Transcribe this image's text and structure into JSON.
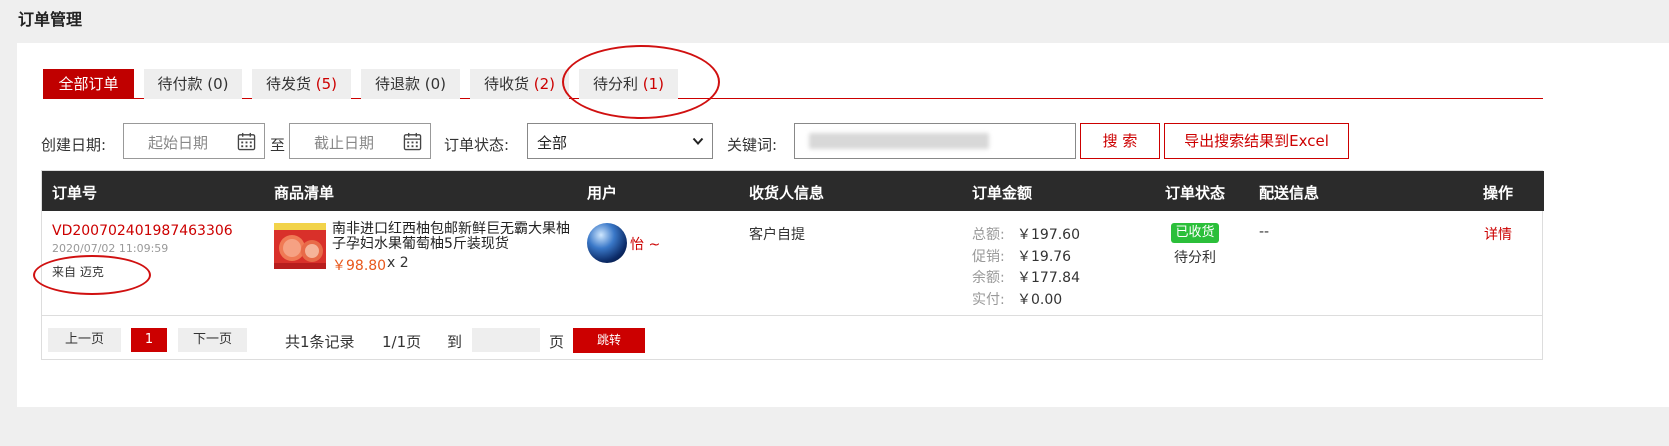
{
  "page": {
    "title": "订单管理"
  },
  "tabs": [
    {
      "label": "全部订单",
      "count": ""
    },
    {
      "label": "待付款",
      "count": "(0)"
    },
    {
      "label": "待发货",
      "count": "(5)"
    },
    {
      "label": "待退款",
      "count": "(0)"
    },
    {
      "label": "待收货",
      "count": "(2)"
    },
    {
      "label": "待分利",
      "count": "(1)"
    }
  ],
  "filters": {
    "date_label": "创建日期:",
    "start_placeholder": "起始日期",
    "to_label": "至",
    "end_placeholder": "截止日期",
    "status_label": "订单状态:",
    "status_value": "全部",
    "keyword_label": "关键词:",
    "search_button": "搜 索",
    "export_button": "导出搜索结果到Excel"
  },
  "table": {
    "headers": [
      "订单号",
      "商品清单",
      "用户",
      "收货人信息",
      "订单金额",
      "订单状态",
      "配送信息",
      "操作"
    ],
    "rows": [
      {
        "order_no": "VD200702401987463306",
        "time": "2020/07/02 11:09:59",
        "source": "来自 迈克",
        "product_name": "南非进口红西柚包邮新鲜巨无霸大果柚子孕妇水果葡萄柚5斤装现货",
        "price": "￥98.80",
        "qty": "x 2",
        "user": "怡 ~",
        "receiver": "客户自提",
        "amounts": [
          {
            "label": "总额:",
            "value": "￥197.60"
          },
          {
            "label": "促销:",
            "value": "￥19.76"
          },
          {
            "label": "余额:",
            "value": "￥177.84"
          },
          {
            "label": "实付:",
            "value": "￥0.00"
          }
        ],
        "status_badge": "已收货",
        "status_sub": "待分利",
        "delivery": "--",
        "action": "详情"
      }
    ]
  },
  "pagination": {
    "prev": "上一页",
    "current": "1",
    "next": "下一页",
    "total": "共1条记录",
    "pages": "1/1页",
    "goto": "到",
    "page_unit": "页",
    "jump": "跳转"
  },
  "colors": {
    "accent": "#c00000",
    "success": "#2bbf3a",
    "header_bg": "#2b2b2b",
    "price": "#e8581c"
  }
}
